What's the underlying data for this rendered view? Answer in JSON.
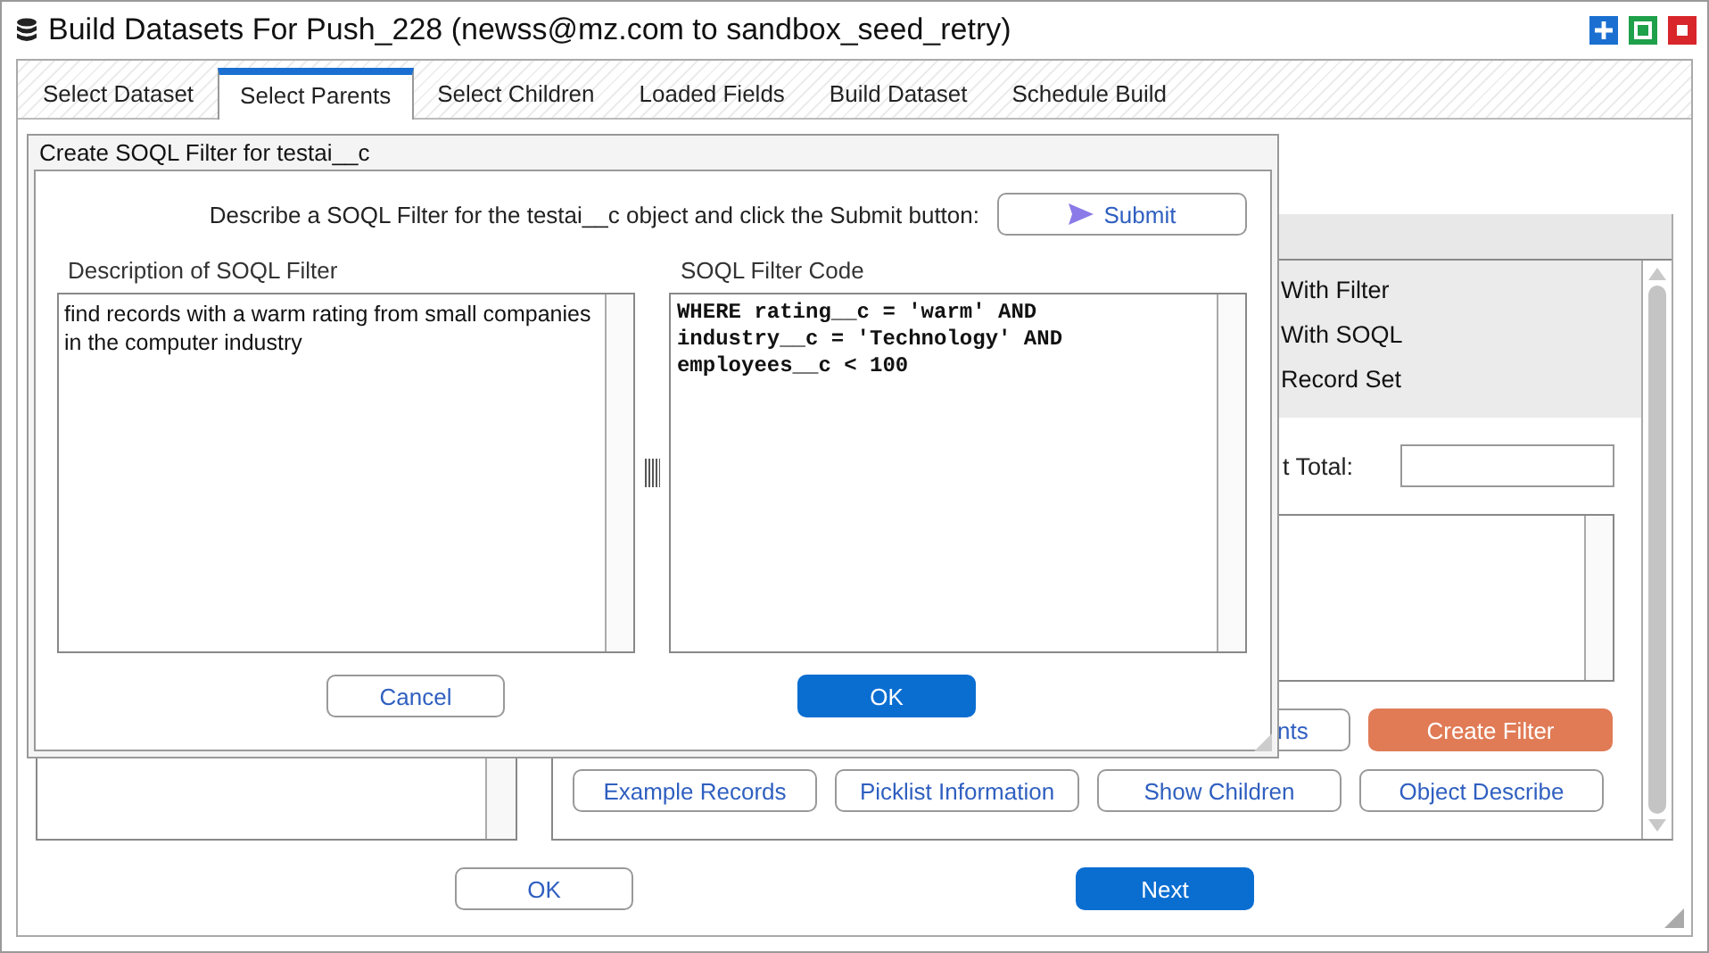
{
  "window": {
    "title": "Build Datasets For Push_228 (newss@mz.com to sandbox_seed_retry)"
  },
  "tabs": [
    {
      "label": "Select Dataset",
      "selected": false
    },
    {
      "label": "Select Parents",
      "selected": true
    },
    {
      "label": "Select Children",
      "selected": false
    },
    {
      "label": "Loaded Fields",
      "selected": false
    },
    {
      "label": "Build Dataset",
      "selected": false
    },
    {
      "label": "Schedule Build",
      "selected": false
    }
  ],
  "background": {
    "list_items": [
      "With Filter",
      "With SOQL",
      "Record Set"
    ],
    "total_label": "t Total:",
    "action_buttons": [
      {
        "label": "nts",
        "kind": "secondary"
      },
      {
        "label": "Create Filter",
        "kind": "accent"
      }
    ],
    "buttons": [
      {
        "label": "Example Records",
        "kind": "secondary"
      },
      {
        "label": "Picklist Information",
        "kind": "secondary"
      },
      {
        "label": "Show Children",
        "kind": "secondary"
      },
      {
        "label": "Object Describe",
        "kind": "secondary"
      }
    ]
  },
  "dialog": {
    "title": "Create SOQL Filter for testai__c",
    "instruction": "Describe a SOQL Filter for the testai__c object and click the Submit button:",
    "submit_button": "Submit",
    "description_label": "Description of SOQL Filter",
    "description": "find records with a warm rating from small companies in the computer industry",
    "code_label": "SOQL Filter Code",
    "code": "WHERE rating__c = 'warm' AND\nindustry__c = 'Technology' AND\nemployees__c < 100",
    "buttons": [
      {
        "label": "Cancel",
        "kind": "secondary"
      },
      {
        "label": "OK",
        "kind": "primary"
      }
    ]
  },
  "footer_buttons": [
    {
      "label": "OK",
      "kind": "secondary"
    },
    {
      "label": "Next",
      "kind": "primary"
    }
  ]
}
